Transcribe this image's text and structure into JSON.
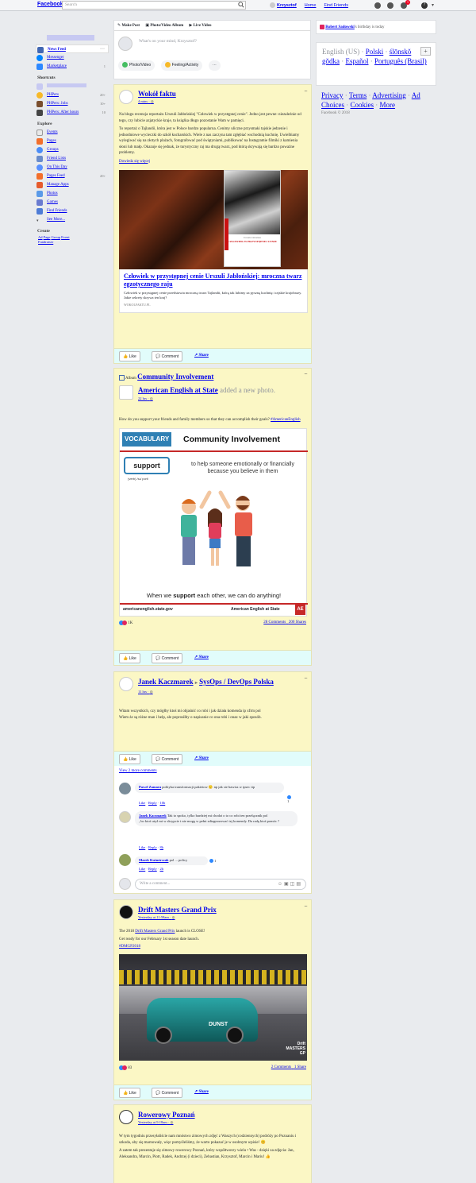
{
  "topbar": {
    "brand": "Facebook",
    "search_placeholder": "Search",
    "user": "Krzysztof",
    "home": "Home",
    "find_friends": "Find Friends",
    "notif_count": "1"
  },
  "nav": {
    "news_feed": "News Feed",
    "messenger": "Messenger",
    "marketplace": "Marketplace",
    "marketplace_count": "1",
    "shortcuts_h": "Shortcuts",
    "sc1": "PHPers",
    "sc1_count": "20+",
    "sc2": "PHPers: Jobs",
    "sc2_count": "10+",
    "sc3": "PHPers: After hours",
    "sc3_count": "10",
    "explore_h": "Explore",
    "events": "Events",
    "pages": "Pages",
    "groups": "Groups",
    "friend_lists": "Friend Lists",
    "on_this_day": "On This Day",
    "pages_feed": "Pages Feed",
    "pages_feed_count": "20+",
    "manage_apps": "Manage Apps",
    "photos": "Photos",
    "games": "Games",
    "find_friends": "Find Friends",
    "see_more": "See More...",
    "create_h": "Create",
    "create_links": [
      "Ad",
      "Page",
      "Group",
      "Event",
      "Fundraiser"
    ]
  },
  "composer": {
    "make_post": "Make Post",
    "album": "Photo/Video Album",
    "live": "Live Video",
    "prompt": "What's on your mind, Krzysztof?",
    "photo": "Photo/Video",
    "feeling": "Feeling/Activity",
    "more": "···"
  },
  "right": {
    "birthday_name": "Robert Sadowski",
    "birthday_text": "'s birthday is today",
    "langs": [
      "English (US)",
      "Polski",
      "ślōnskŏ gŏdka",
      "Español",
      "Português (Brasil)"
    ],
    "footer_links": [
      "Privacy",
      "Terms",
      "Advertising",
      "Ad Choices",
      "Cookies",
      "More"
    ],
    "copyright": "Facebook © 2018"
  },
  "buttons": {
    "like": "Like",
    "comment": "Comment",
    "share": "Share"
  },
  "post1": {
    "name": "Wokół faktu",
    "time": "4 mins",
    "p1": "Na blogu recenzja reportażu Urszuli Jabłońskiej \"Człowiek w przystępnej cenie\". Jedno jest pewne: niezależnie od tego, czy lubicie azjatyckie kraje, ta książka długo pozostanie Wam w pamięci.",
    "p2": "To reportaż o Tajlandii, która jest w Polsce bardzo popularna. Cenimy uliczne przysmaki tajskie jedzenie i jednodniowe wycieczki do szkół kucharskich. Wiele z nas zaczyna tam zgłębiać wschodnią kuchnię. Uwielbiamy wylegiwać się na złotych plażach, fotografować pod świątyniami, publikować na Instagramie filmiki z kamienia słoni lub małp. Okazuje się jednak, że turystyczny raj ma drugą twarz, pod którą skrywają się bardzo poważne problemy.",
    "more": "Dowiedz się więcej",
    "link_title": "Człowiek w przystępnej cenie Urszuli Jabłońskiej: mroczna twarz egzotycznego raju",
    "link_desc": "Człowiek w przystępnej cenie przedstawia mroczną twarz Tajlandii, którą tak lubimy za pyszną kuchnię i rajskie krajobrazy. Jakie sekrety skrywa ten kraj?",
    "link_domain": "WOKOLFAKTU.PL",
    "book_author": "Urszula Jabłońska",
    "book_title": "CZŁOWIEK W PRZYSTĘPNEJ CENIE"
  },
  "post2": {
    "album_label": "Album",
    "album": "Community Involvement",
    "name": "American English at State",
    "added": "added a new photo.",
    "time": "22 hrs",
    "text": "How do you support your friends and family members so that they can accomplish their goals?",
    "hashtag": "#AmericanEnglish",
    "img": {
      "vocab": "VOCABULARY",
      "title": "Community Involvement",
      "word": "support",
      "pron": "(verb) /səˈpɔrt/",
      "def": "to help someone emotionally or financially because you believe in them",
      "quote_pre": "When we ",
      "quote_bold": "support",
      "quote_post": " each other, we can do anything!",
      "url": "americanenglish.state.gov",
      "brand": "American English at State",
      "ae": "AE"
    },
    "reactions": "1K",
    "comments": "28 Comments",
    "shares": "200 Shares"
  },
  "post3": {
    "name": "Janek Kaczmarek",
    "group": "SysOps / DevOps Polska",
    "time": "11 hrs",
    "l1": "Witam wszystkich, czy mógłby ktoś mi objaśnić co robi i jak działa komenda ip xfrm pol",
    "l2": "Wiem że są różne man i help, ale poprosiłby o napisanie co ona robi i onaz w jaki sposób.",
    "view_more": "View 2 more comments",
    "c1_name": "Paweł Zamara",
    "c1_text": "polityka transformacji pakietow 🙂 np jak sie bawisz w ipsec itp",
    "c1_time": "10h",
    "c1_likes": "1",
    "c2_name": "Janek Kaczmarek",
    "c2_text": "Tak to spoko, tylko bardziej mi chodzi o to co robi ten przełącznik pol",
    "c2_text2": ", bo ktoś użył mi w skrypcie i nie mogę w pełni zdiagnozować tej komendy. Da radę ktoś pomóc ?",
    "c2_time": "8h",
    "c3_name": "Marek Kuśmirczak",
    "c3_text": "pol ... policy",
    "c3_time": "2h",
    "c3_likes": "1",
    "reply": "Reply",
    "like_l": "Like",
    "write": "Write a comment..."
  },
  "post4": {
    "name": "Drift Masters Grand Prix",
    "time": "Yesterday at 11:58am",
    "l1_pre": "The 2018 ",
    "l1_link": "Drift Masters Grand Prix",
    "l1_post": " launch is CLOSE!",
    "l2": "Get ready for our February 1st season date launch.",
    "hashtag": "#DMGP2018",
    "reactions": "83",
    "comments": "2 Comments",
    "shares": "1 Share",
    "logo": "Drift MASTERS GP",
    "car_text": "DUNST"
  },
  "post5": {
    "name": "Rowerowy Poznań",
    "time": "Yesterday at 9:18am",
    "p1": "W tym tygodniu przesyłaliście nam mnóstwo zimowych zdjęć z Waszych (codziennych) podróży po Poznaniu i szkoda, aby się marnowały, więc pomyśleliśmy, że warto pokazać je w osobnym wpisie! 😊",
    "p2": "A zatem tak prezentuje się zimowy rowerowy Poznań, który współtworzy wielu • Was - dzięki za zdjęcia: Jan, Aleksandra, Marcin, Piotr, Radek, Andrzej (i dzieci), Zebastian, Krzysztof, Marcin i Mariu! 👍"
  }
}
